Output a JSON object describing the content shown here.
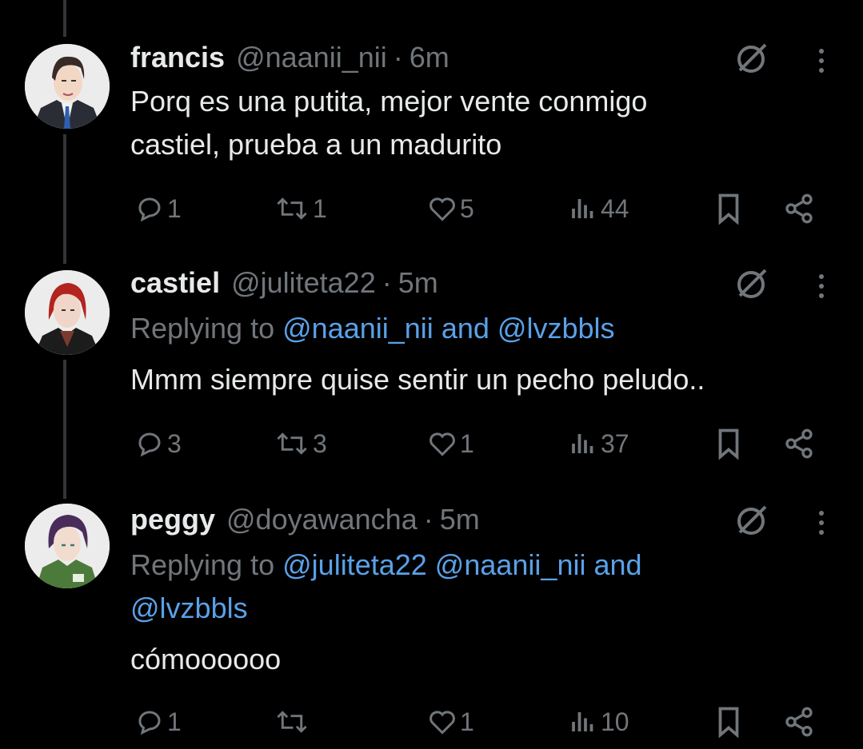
{
  "tweets": [
    {
      "name": "francis",
      "handle": "@naanii_nii",
      "time": "6m",
      "reply_prefix": "",
      "reply_mentions": [],
      "text_lines": [
        "Porq es una putita, mejor vente conmigo",
        "castiel, prueba a un madurito"
      ],
      "replies": "1",
      "retweets": "1",
      "likes": "5",
      "views": "44",
      "avatar_desc": "anime man with dark hair in suit and blue tie"
    },
    {
      "name": "castiel",
      "handle": "@juliteta22",
      "time": "5m",
      "reply_prefix": "Replying to",
      "reply_mentions": [
        "@naanii_nii",
        "and",
        "@lvzbbls"
      ],
      "text_lines": [
        "Mmm siempre quise sentir un pecho peludo.."
      ],
      "replies": "3",
      "retweets": "3",
      "likes": "1",
      "views": "37",
      "avatar_desc": "anime boy with red hair in black jacket"
    },
    {
      "name": "peggy",
      "handle": "@doyawancha",
      "time": "5m",
      "reply_prefix": "Replying to",
      "reply_mentions": [
        "@juliteta22",
        "@naanii_nii",
        "and",
        "@lvzbbls"
      ],
      "text_lines": [
        "cómoooooo"
      ],
      "replies": "1",
      "retweets": "",
      "likes": "1",
      "views": "10",
      "avatar_desc": "anime girl with purple hair in green hoodie"
    }
  ],
  "colors": {
    "background": "#000000",
    "text": "#e7e9ea",
    "secondary": "#71767b",
    "link": "#5aa1e8",
    "thread_line": "#333639"
  },
  "icons": [
    "reply-icon",
    "retweet-icon",
    "like-icon",
    "views-icon",
    "bookmark-icon",
    "share-icon",
    "grok-icon",
    "more-icon"
  ]
}
